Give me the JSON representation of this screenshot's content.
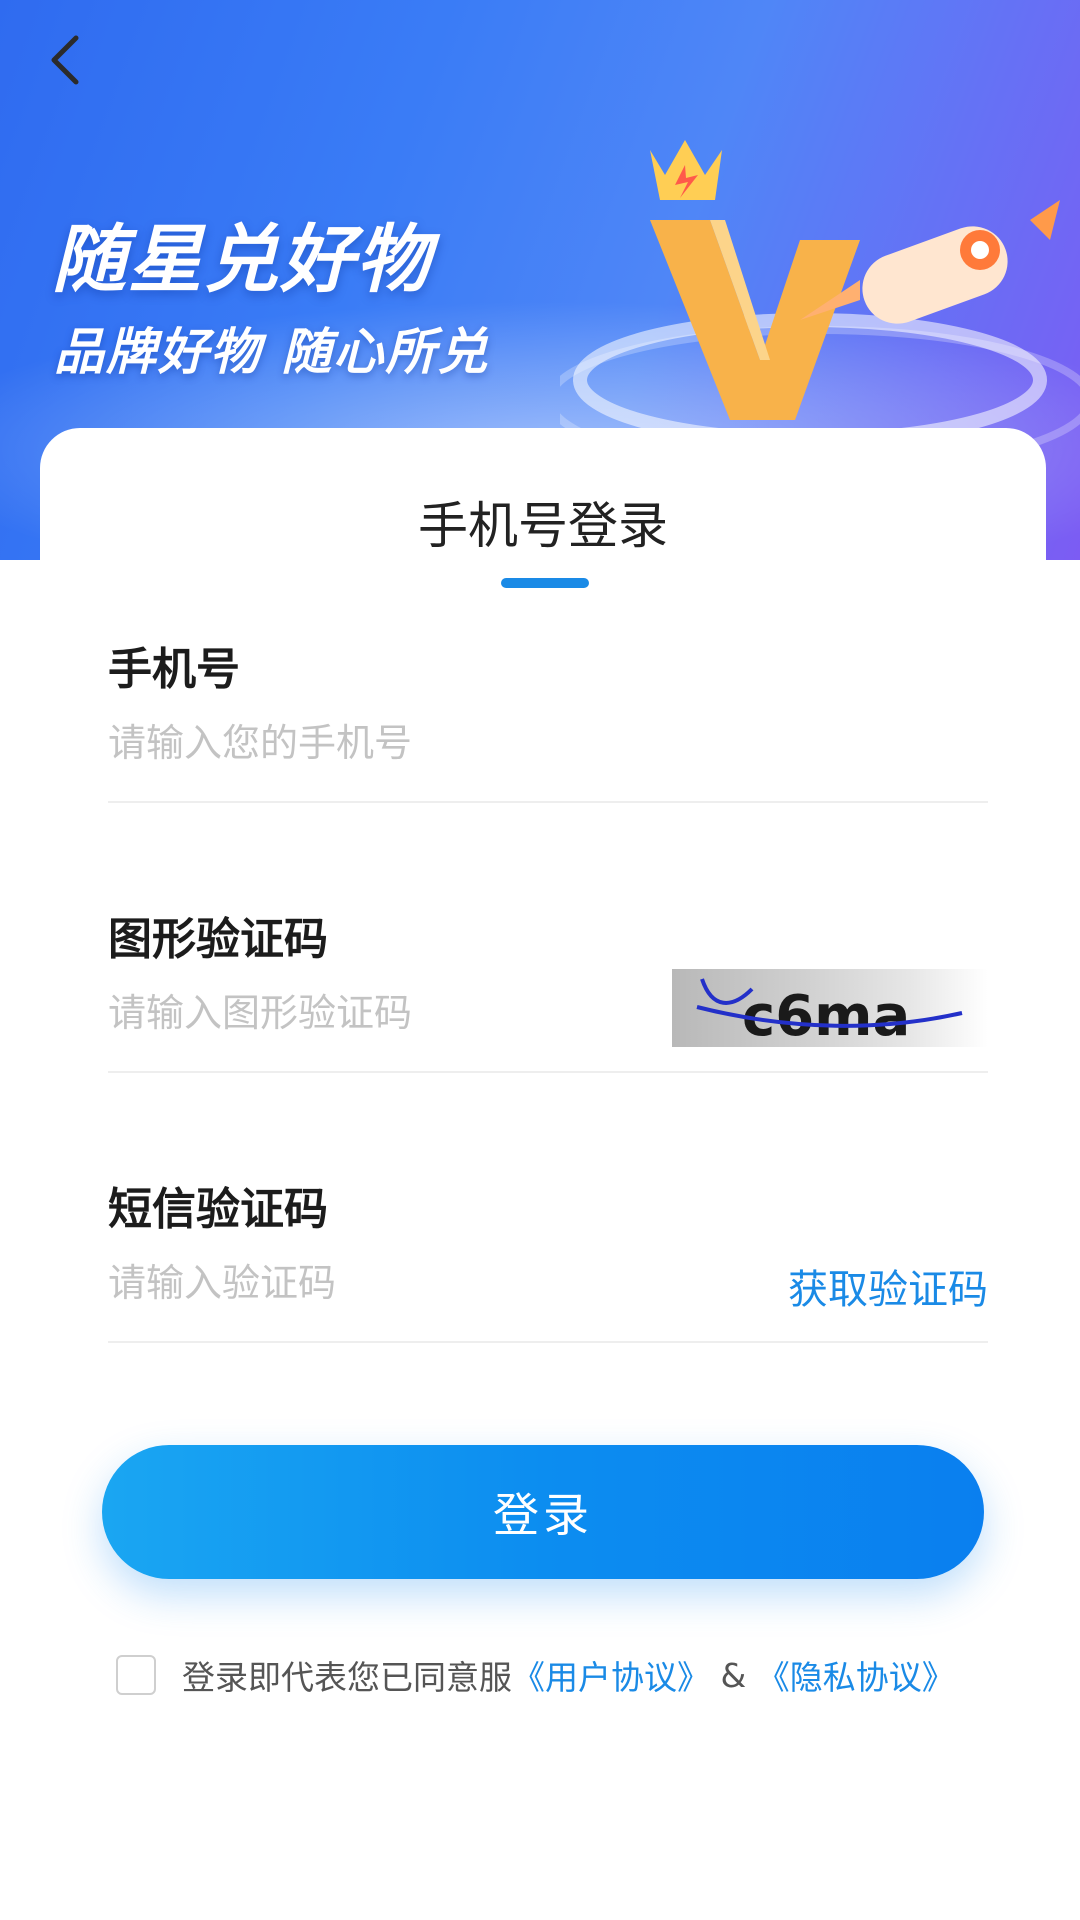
{
  "banner": {
    "title": "随星兑好物",
    "subtitle": "品牌好物 随心所兑"
  },
  "icons": {
    "back": "chevron-left-icon",
    "art": "crown-v-rocket-illustration"
  },
  "login": {
    "title": "手机号登录",
    "phone": {
      "label": "手机号",
      "placeholder": "请输入您的手机号",
      "value": ""
    },
    "captcha": {
      "label": "图形验证码",
      "placeholder": "请输入图形验证码",
      "value": "",
      "image_text": "c6ma"
    },
    "sms": {
      "label": "短信验证码",
      "placeholder": "请输入验证码",
      "value": "",
      "send_label": "获取验证码"
    },
    "submit_label": "登录"
  },
  "agreement": {
    "checked": false,
    "prefix": "登录即代表您已同意服",
    "user_agreement": "《用户协议》",
    "separator": " & ",
    "privacy_agreement": "《隐私协议》"
  },
  "colors": {
    "accent": "#1a8ae6",
    "banner_start": "#2f6bf0",
    "banner_end": "#7c5cf3",
    "button_start": "#1aa6f2",
    "button_end": "#0a7fef"
  }
}
